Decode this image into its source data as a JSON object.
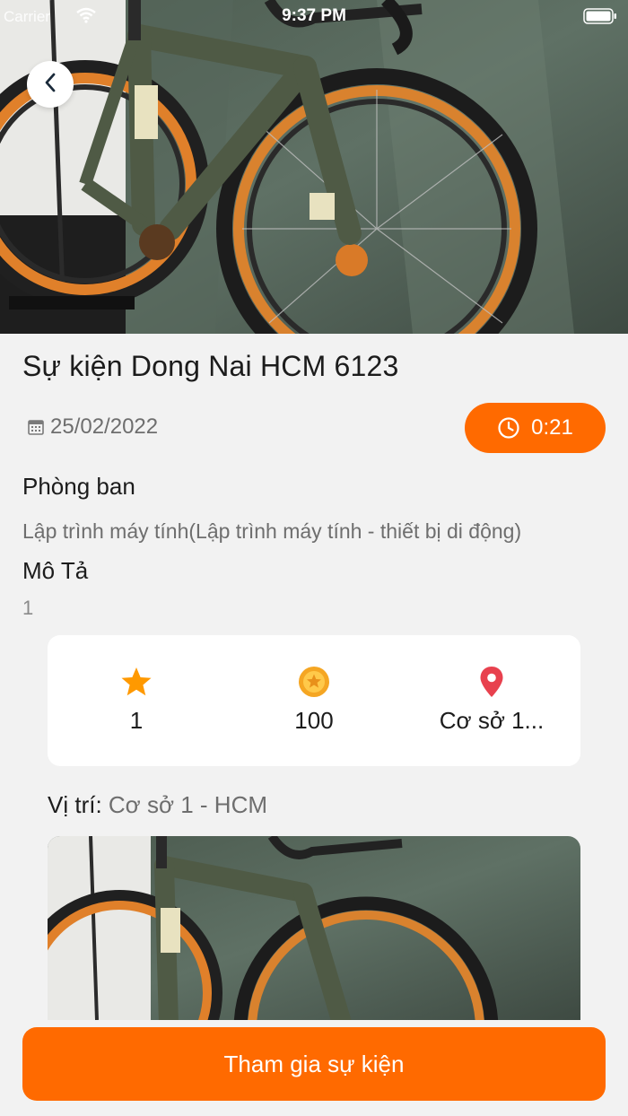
{
  "status_bar": {
    "carrier": "Carrier",
    "time": "9:37 PM"
  },
  "icons": {
    "back": "chevron-left-icon",
    "calendar": "calendar-icon",
    "clock": "clock-icon",
    "star": "star-icon",
    "coin": "coin-icon",
    "location": "map-pin-icon",
    "wifi": "wifi-icon",
    "battery": "battery-icon"
  },
  "colors": {
    "accent": "#ff6a00",
    "star": "#ff9900",
    "coin": "#f5a623",
    "pin": "#e8414e",
    "background": "#f2f2f2"
  },
  "event": {
    "title": "Sự kiện Dong Nai HCM 6123",
    "date": "25/02/2022",
    "timer": "0:21",
    "department_label": "Phòng ban",
    "department_value": "Lập trình máy tính(Lập trình máy tính - thiết bị di động)",
    "description_label": "Mô Tả",
    "description_value": "1"
  },
  "stats": {
    "stars": "1",
    "points": "100",
    "location_short": "Cơ sở 1..."
  },
  "location": {
    "label": "Vị trí:",
    "value": "Cơ sở 1 - HCM"
  },
  "cta": {
    "join_label": "Tham gia sự kiện"
  }
}
